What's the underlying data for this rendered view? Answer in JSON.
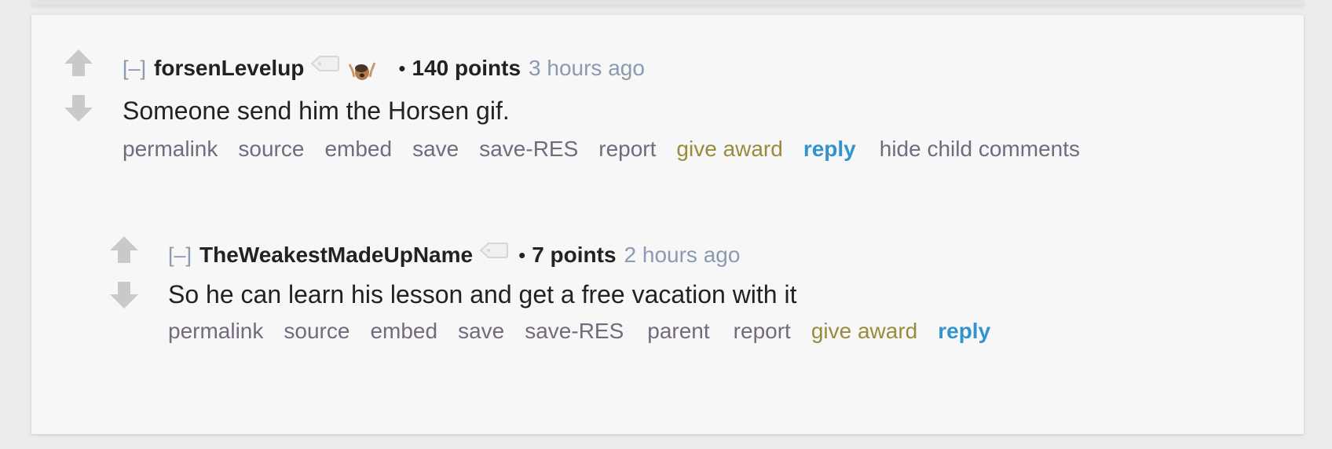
{
  "colors": {
    "background": "#ececec",
    "card": "#f7f7f7",
    "arrow": "#c9c9c9",
    "author": "#222222",
    "muted": "#8b9ab0",
    "link": "#736a7e",
    "award": "#9a8b3c",
    "reply": "#3393cc"
  },
  "comments": [
    {
      "expand_label": "[–]",
      "author": "forsenLevelup",
      "has_user_tag": true,
      "flair": "forsen-emote",
      "bullet": "•",
      "score": "140 points",
      "time": "3 hours ago",
      "body": "Someone send him the Horsen gif.",
      "buttons": {
        "permalink": "permalink",
        "source": "source",
        "embed": "embed",
        "save": "save",
        "save_res": "save-RES",
        "report": "report",
        "give_award": "give award",
        "reply": "reply",
        "hide_child": "hide child comments"
      }
    },
    {
      "expand_label": "[–]",
      "author": "TheWeakestMadeUpName",
      "has_user_tag": true,
      "bullet": "•",
      "score": "7 points",
      "time": "2 hours ago",
      "body": "So he can learn his lesson and get a free vacation with it",
      "buttons": {
        "permalink": "permalink",
        "source": "source",
        "embed": "embed",
        "save": "save",
        "save_res": "save-RES",
        "parent": "parent",
        "report": "report",
        "give_award": "give award",
        "reply": "reply"
      }
    }
  ]
}
